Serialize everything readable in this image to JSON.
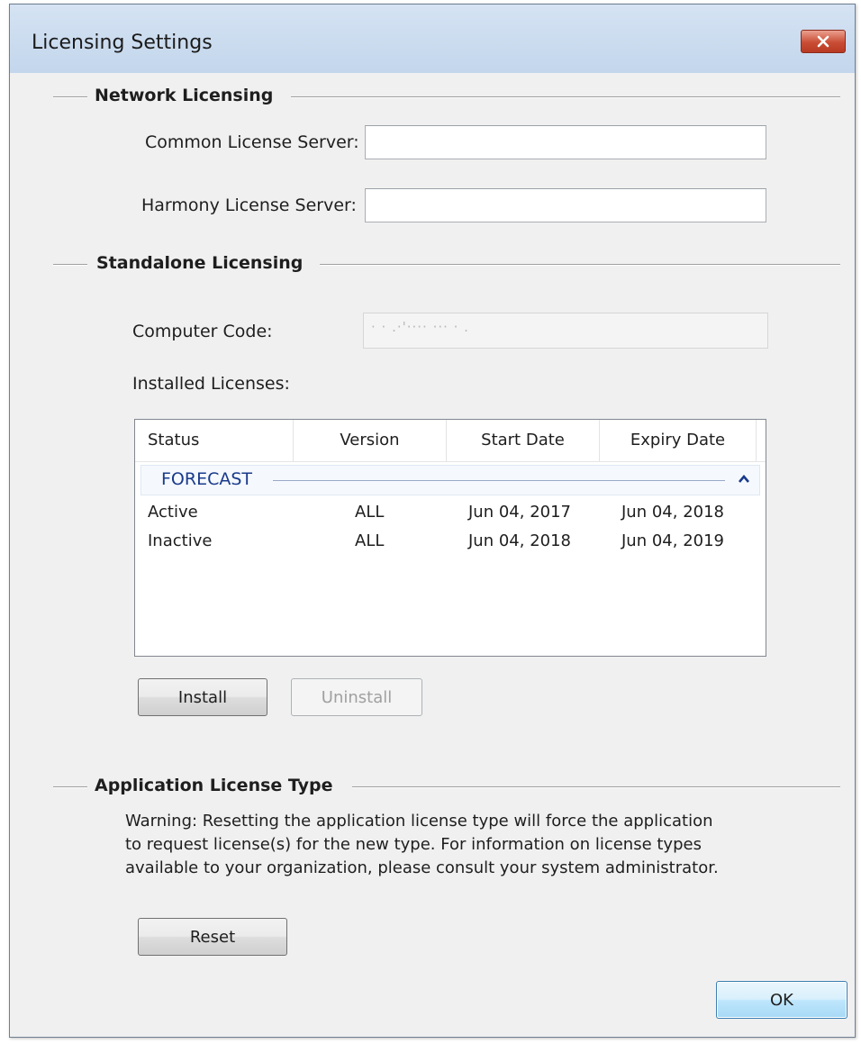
{
  "window": {
    "title": "Licensing Settings"
  },
  "network": {
    "title": "Network Licensing",
    "common_label": "Common License Server:",
    "common_value": "",
    "harmony_label": "Harmony License Server:",
    "harmony_value": ""
  },
  "standalone": {
    "title": "Standalone Licensing",
    "computer_code_label": "Computer Code:",
    "computer_code_value": "·  · .·'···· ··· · .",
    "installed_label": "Installed Licenses:",
    "columns": [
      "Status",
      "Version",
      "Start Date",
      "Expiry Date"
    ],
    "group": "FORECAST",
    "rows": [
      {
        "status": "Active",
        "version": "ALL",
        "start": "Jun 04, 2017",
        "expiry": "Jun 04, 2018"
      },
      {
        "status": "Inactive",
        "version": "ALL",
        "start": "Jun 04, 2018",
        "expiry": "Jun 04, 2019"
      }
    ],
    "install_label": "Install",
    "uninstall_label": "Uninstall"
  },
  "app_license": {
    "title": "Application License Type",
    "warning_lines": [
      "Warning: Resetting the application license type will force the application",
      "to request license(s) for the new type. For information on license types",
      "available to your organization, please consult your system administrator."
    ],
    "reset_label": "Reset"
  },
  "footer": {
    "ok_label": "OK"
  }
}
